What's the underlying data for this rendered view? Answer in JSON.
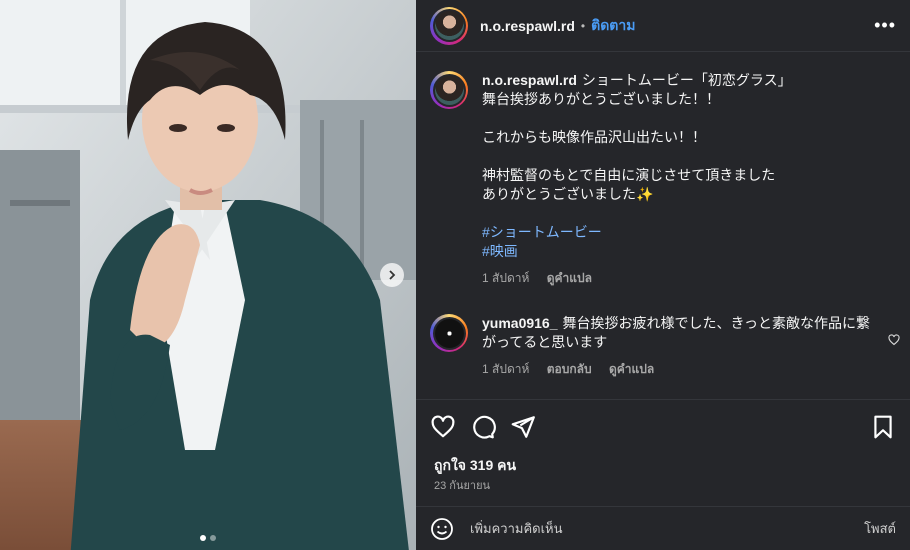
{
  "header": {
    "username": "n.o.respawl.rd",
    "follow_label": "ติดตาม",
    "separator": "•",
    "more_icon": "more-horizontal-icon"
  },
  "caption": {
    "username": "n.o.respawl.rd",
    "lines": [
      "ショートムービー「初恋グラス」",
      "舞台挨拶ありがとうございました！！",
      "",
      "これからも映像作品沢山出たい！！",
      "",
      "神村監督のもとで自由に演じさせて頂きました",
      "ありがとうございました✨"
    ],
    "hashtags": [
      "#ショートムービー",
      "#映画"
    ],
    "time": "1 สัปดาห์",
    "see_translation": "ดูคำแปล"
  },
  "comments": [
    {
      "username": "yuma0916_",
      "text": "舞台挨拶お疲れ様でした、きっと素敵な作品に繋がってると思います",
      "time": "1 สัปดาห์",
      "reply": "ตอบกลับ",
      "see_translation": "ดูคำแปล"
    }
  ],
  "actions": {
    "like_icon": "heart-icon",
    "comment_icon": "comment-icon",
    "share_icon": "share-icon",
    "save_icon": "bookmark-icon"
  },
  "likes_text": "ถูกใจ 319 คน",
  "date_text": "23 กันยายน",
  "add_comment": {
    "placeholder": "เพิ่มความคิดเห็น",
    "post_label": "โพสต์",
    "emoji_icon": "emoji-icon"
  },
  "carousel": {
    "next_icon": "chevron-right-icon",
    "total_slides": 2,
    "current_slide": 1
  },
  "colors": {
    "panel_bg": "#25262a",
    "accent_link": "#4a9cf5",
    "hashtag": "#7eb8ff"
  }
}
